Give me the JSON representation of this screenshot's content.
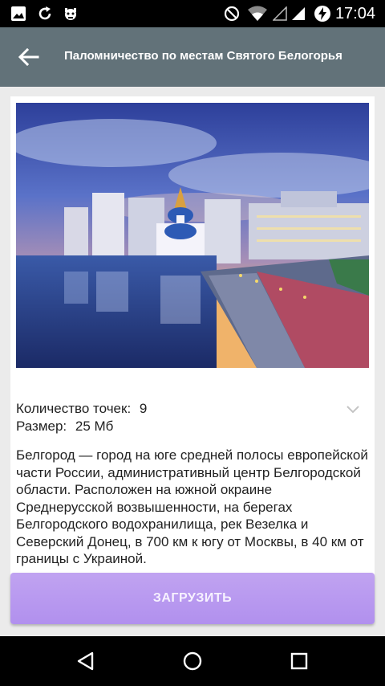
{
  "status_bar": {
    "time": "17:04",
    "left_icons": [
      "image-icon",
      "sync-icon",
      "android-debug-icon"
    ],
    "right_icons": [
      "do-not-disturb-icon",
      "wifi-icon",
      "signal-empty-icon",
      "signal-icon",
      "battery-charging-icon"
    ]
  },
  "app_bar": {
    "title": "Паломничество по местам Святого Белогорья",
    "background": "#627279"
  },
  "tour": {
    "points_label": "Количество точек:",
    "points_value": "9",
    "size_label": "Размер:",
    "size_value": "25 Мб",
    "description": "Белгород — город на юге средней полосы европейской части России, административный центр Белгородской области. Расположен на южной окраине Среднерусской возвышенности, на берегах Белгородского водохранилища, рек Везелка и Северский Донец, в 700 км к югу от Москвы, в 40 км от границы с Украиной."
  },
  "download_button": {
    "label": "ЗАГРУЗИТЬ",
    "color": "#b99af0"
  },
  "nav_bar": {
    "icons": [
      "back-triangle-icon",
      "home-circle-icon",
      "recents-square-icon"
    ]
  }
}
